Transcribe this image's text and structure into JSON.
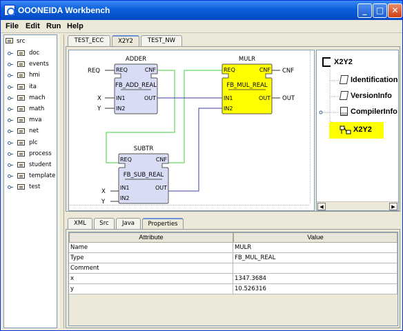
{
  "window": {
    "title": "OOONEIDA Workbench",
    "minimize": "_",
    "maximize": "□",
    "close": "✕"
  },
  "menu": [
    "File",
    "Edit",
    "Run",
    "Help"
  ],
  "tree": {
    "root": "src",
    "items": [
      "doc",
      "events",
      "hmi",
      "ita",
      "mach",
      "math",
      "mva",
      "net",
      "plc",
      "process",
      "student",
      "template",
      "test"
    ]
  },
  "editor_tabs": [
    "TEST_ECC",
    "X2Y2",
    "TEST_NW"
  ],
  "selected_editor_tab": "X2Y2",
  "diagram": {
    "blocks": [
      {
        "name": "ADDER",
        "type": "FB_ADD_REAL",
        "event_in": "REQ",
        "event_out": "CNF",
        "data_in": [
          "IN1",
          "IN2"
        ],
        "data_out": "OUT",
        "selected": false
      },
      {
        "name": "MULR",
        "type": "FB_MUL_REAL",
        "event_in": "REQ",
        "event_out": "CNF",
        "data_in": [
          "IN1",
          "IN2"
        ],
        "data_out": "OUT",
        "selected": true
      },
      {
        "name": "SUBTR",
        "type": "FB_SUB_REAL",
        "event_in": "REQ",
        "event_out": "CNF",
        "data_in": [
          "IN1",
          "IN2"
        ],
        "data_out": "OUT",
        "selected": false
      }
    ],
    "external": {
      "req": "REQ",
      "x": "X",
      "y": "Y",
      "cnf": "CNF",
      "out": "OUT"
    }
  },
  "outline": {
    "title": "X2Y2",
    "items": [
      {
        "label": "Identification",
        "icon": "document-icon"
      },
      {
        "label": "VersionInfo",
        "icon": "document-icon"
      },
      {
        "label": "CompilerInfo",
        "icon": "binary-icon"
      },
      {
        "label": "X2Y2",
        "icon": "network-icon",
        "selected": true
      }
    ]
  },
  "bottom_tabs": [
    "XML",
    "Src",
    "Java",
    "Properties"
  ],
  "selected_bottom_tab": "Properties",
  "properties": {
    "headers": [
      "Attribute",
      "Value"
    ],
    "rows": [
      [
        "Name",
        "MULR"
      ],
      [
        "Type",
        "FB_MUL_REAL"
      ],
      [
        "Comment",
        ""
      ],
      [
        "x",
        "1347.3684"
      ],
      [
        "y",
        "10.526316"
      ]
    ]
  },
  "colors": {
    "block_fill": "#d8dcf4",
    "selected_fill": "#ffff00",
    "event_wire": "#3fcf3f",
    "data_wire": "#4040a0",
    "outline_highlight": "#ffff00",
    "titlebar": "#0a5fd8"
  }
}
